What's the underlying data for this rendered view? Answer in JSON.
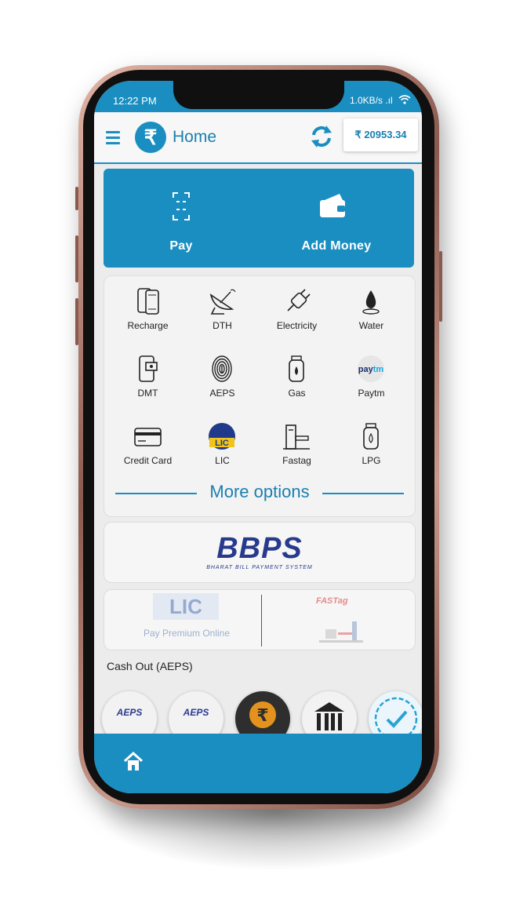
{
  "status": {
    "time": "12:22 PM",
    "network": "1.0KB/s .ıl"
  },
  "header": {
    "title": "Home",
    "balance": "₹ 20953.34",
    "logo_glyph": "₹"
  },
  "actions": {
    "pay_label": "Pay",
    "add_money_label": "Add Money"
  },
  "services": [
    {
      "label": "Recharge"
    },
    {
      "label": "DTH"
    },
    {
      "label": "Electricity"
    },
    {
      "label": "Water"
    },
    {
      "label": "DMT"
    },
    {
      "label": "AEPS"
    },
    {
      "label": "Gas"
    },
    {
      "label": "Paytm"
    },
    {
      "label": "Credit Card"
    },
    {
      "label": "LIC"
    },
    {
      "label": "Fastag"
    },
    {
      "label": "LPG"
    }
  ],
  "more_options": "More options",
  "bbps": {
    "logo": "BBPS",
    "tagline": "BHARAT BILL PAYMENT SYSTEM"
  },
  "banner": {
    "lic_logo": "LIC",
    "lic_caption": "Pay Premium Online",
    "fastag_logo": "FASTag"
  },
  "cashout": {
    "title": "Cash Out (AEPS)",
    "aeps_label": "AEPS"
  },
  "colors": {
    "primary": "#1a8ec0",
    "background": "#ececec"
  }
}
